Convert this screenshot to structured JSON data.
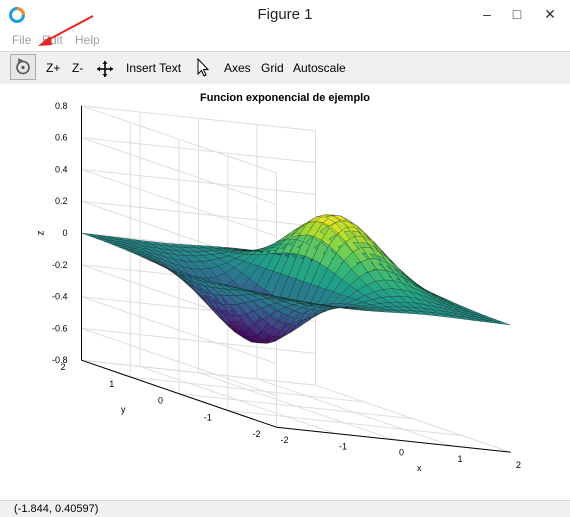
{
  "window": {
    "title": "Figure 1"
  },
  "menu": {
    "items": [
      "File",
      "Edit",
      "Help"
    ]
  },
  "toolbar": {
    "zoom_in": "Z+",
    "zoom_out": "Z-",
    "insert_text": "Insert Text",
    "axes": "Axes",
    "grid": "Grid",
    "autoscale": "Autoscale"
  },
  "chart_data": {
    "type": "surface",
    "title": "Funcion exponencial de ejemplo",
    "xlabel": "x",
    "ylabel": "y",
    "zlabel": "z",
    "xlim": [
      -2,
      2
    ],
    "ylim": [
      -2,
      2
    ],
    "zlim": [
      -0.8,
      0.8
    ],
    "xticks": [
      "-2",
      "-1",
      "0",
      "1",
      "2"
    ],
    "yticks": [
      "-2",
      "-1",
      "0",
      "1",
      "2"
    ],
    "zticks": [
      "0.8",
      "0.6",
      "0.4",
      "0.2",
      "0",
      "-0.2",
      "-0.4",
      "-0.6",
      "-0.8"
    ],
    "function": "z = x * exp(-x^2 - y^2)",
    "colormap": "viridis",
    "grid": true
  },
  "status": {
    "coords": "(-1.844, 0.40597)"
  },
  "colors": {
    "arrow": "#e8231e",
    "toolbar_bg": "#f0f0f0"
  }
}
